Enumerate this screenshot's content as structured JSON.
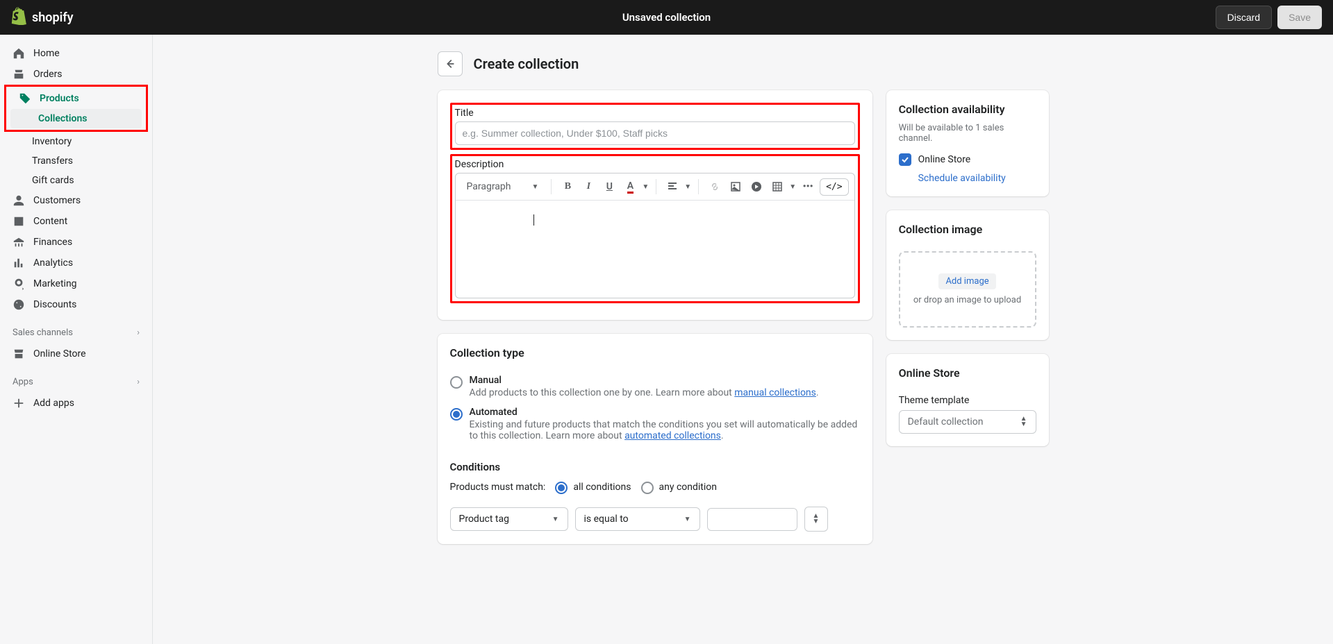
{
  "topbar": {
    "brand": "shopify",
    "title": "Unsaved collection",
    "discard": "Discard",
    "save": "Save"
  },
  "sidebar": {
    "home": "Home",
    "orders": "Orders",
    "products": "Products",
    "collections": "Collections",
    "inventory": "Inventory",
    "transfers": "Transfers",
    "gift_cards": "Gift cards",
    "customers": "Customers",
    "content": "Content",
    "finances": "Finances",
    "analytics": "Analytics",
    "marketing": "Marketing",
    "discounts": "Discounts",
    "sales_channels": "Sales channels",
    "online_store": "Online Store",
    "apps": "Apps",
    "add_apps": "Add apps"
  },
  "page": {
    "title": "Create collection"
  },
  "form": {
    "title_label": "Title",
    "title_placeholder": "e.g. Summer collection, Under $100, Staff picks",
    "desc_label": "Description",
    "paragraph": "Paragraph"
  },
  "type": {
    "heading": "Collection type",
    "manual_label": "Manual",
    "manual_desc": "Add products to this collection one by one. Learn more about ",
    "manual_link": "manual collections",
    "auto_label": "Automated",
    "auto_desc1": "Existing and future products that match the conditions you set will automatically be added to this collection. Learn more about ",
    "auto_link": "automated collections"
  },
  "conditions": {
    "heading": "Conditions",
    "match_label": "Products must match:",
    "all": "all conditions",
    "any": "any condition",
    "field1": "Product tag",
    "field2": "is equal to"
  },
  "availability": {
    "heading": "Collection availability",
    "sub": "Will be available to 1 sales channel.",
    "online_store": "Online Store",
    "schedule": "Schedule availability"
  },
  "image": {
    "heading": "Collection image",
    "add": "Add image",
    "drop": "or drop an image to upload"
  },
  "theme": {
    "heading": "Online Store",
    "label": "Theme template",
    "value": "Default collection"
  }
}
